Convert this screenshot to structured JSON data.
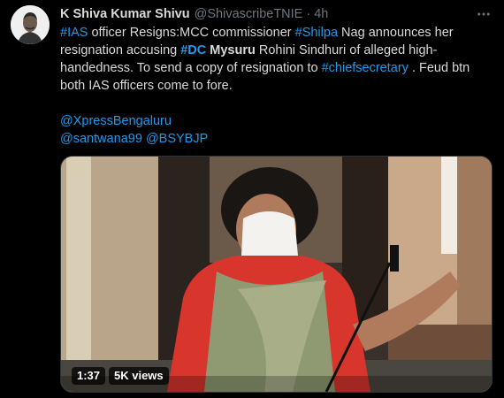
{
  "tweet": {
    "author_name": "K Shiva Kumar Shivu",
    "handle": "@ShivascribeTNIE",
    "separator": "·",
    "time": "4h",
    "more_icon": "ellipsis-icon",
    "body": {
      "l1": {
        "t1": "#IAS",
        "t2": " officer Resigns:MCC commissioner ",
        "t3": "#Shilpa",
        "t4": " Nag announces her"
      },
      "l2": {
        "t1": "resignation accusing ",
        "t2": "#DC",
        "t3": " ",
        "t4": "Mysuru",
        "t5": " Rohini Sindhuri of alleged high-"
      },
      "l3": {
        "t1": "handedness. To send a copy of resignation to ",
        "t2": "#chiefsecretary",
        "t3": " . Feud btn"
      },
      "l4": "both IAS officers come to fore.",
      "l5": "@XpressBengaluru",
      "l6": {
        "m1": "@santwana99",
        "t2": " ",
        "m2": "@BSYBJP"
      }
    },
    "media": {
      "duration": "1:37",
      "views": "5K views"
    }
  },
  "colors": {
    "background": "#000000",
    "text": "#d9d9d9",
    "secondary": "#6e767d",
    "link": "#1d9bf0"
  }
}
